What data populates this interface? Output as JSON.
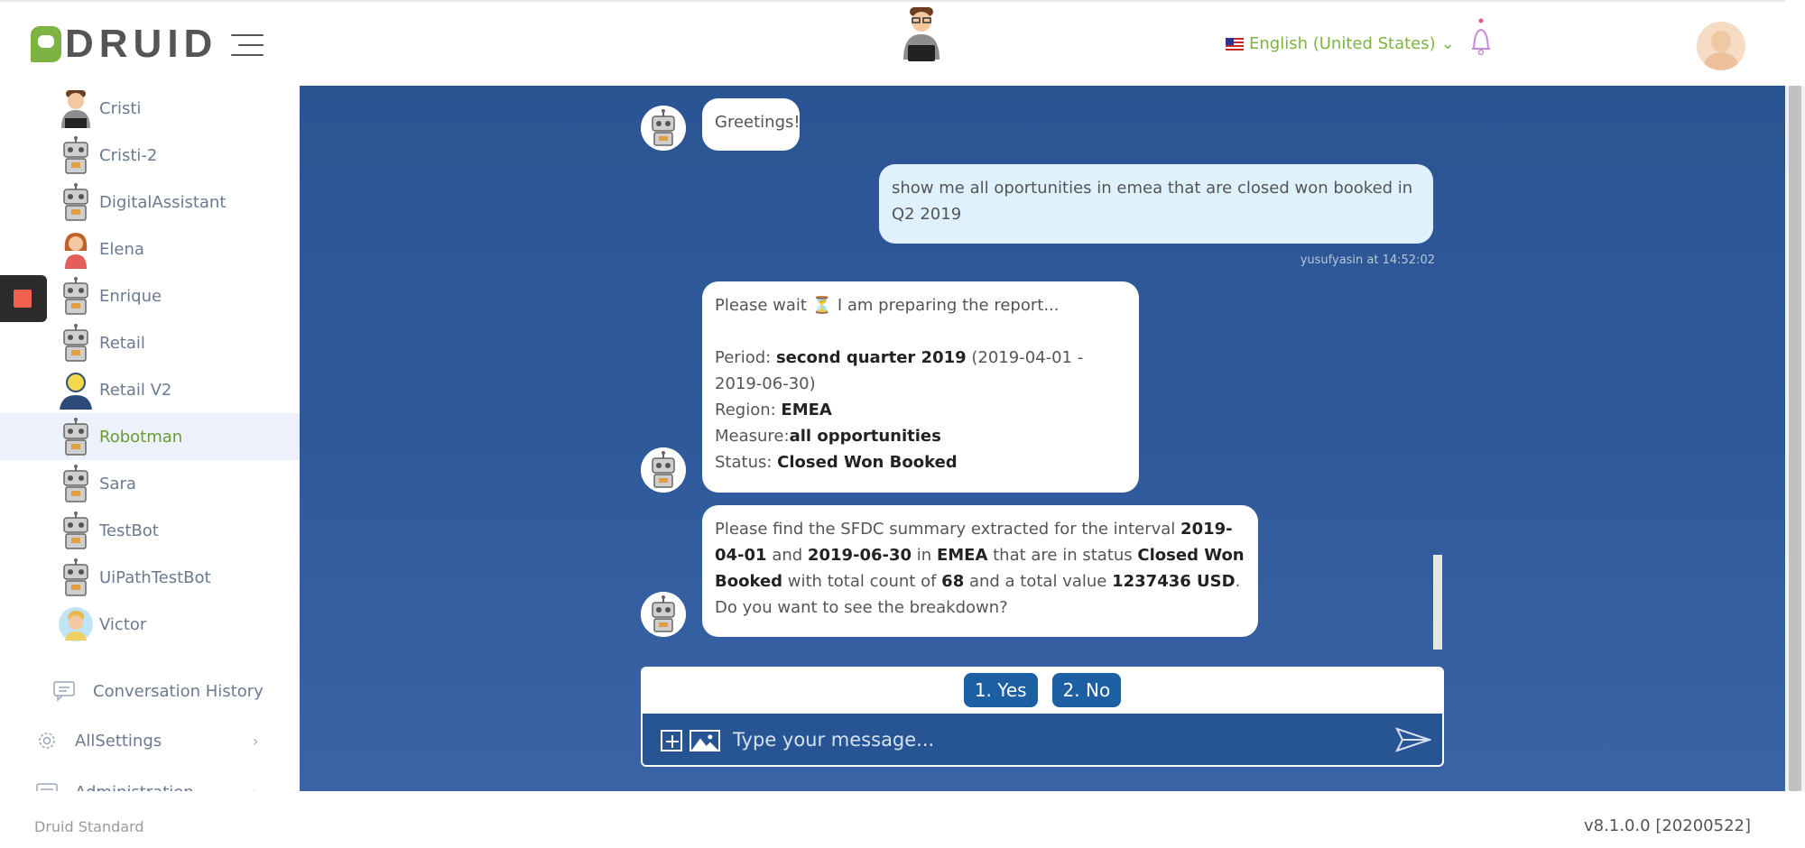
{
  "header": {
    "logo_text": "DRUID",
    "language": "English (United States)"
  },
  "sidebar": {
    "bots": [
      {
        "label": "Cristi",
        "avatar": "person-avatar"
      },
      {
        "label": "Cristi-2",
        "avatar": "robot-avatar"
      },
      {
        "label": "DigitalAssistant",
        "avatar": "robot-avatar"
      },
      {
        "label": "Elena",
        "avatar": "woman-avatar"
      },
      {
        "label": "Enrique",
        "avatar": "robot-avatar"
      },
      {
        "label": "Retail",
        "avatar": "robot-avatar"
      },
      {
        "label": "Retail V2",
        "avatar": "bulb-avatar"
      },
      {
        "label": "Robotman",
        "avatar": "robot-avatar",
        "active": true
      },
      {
        "label": "Sara",
        "avatar": "robot-avatar"
      },
      {
        "label": "TestBot",
        "avatar": "robot-avatar"
      },
      {
        "label": "UiPathTestBot",
        "avatar": "robot-avatar"
      },
      {
        "label": "Victor",
        "avatar": "boy-avatar"
      }
    ],
    "conversation_history": "Conversation History",
    "all_settings": "AllSettings",
    "administration": "Administration"
  },
  "chat": {
    "greeting": "Greetings!",
    "user_message": "show me all oportunities in emea that are closed won booked in Q2 2019",
    "user_meta": "yusufyasin at 14:52:02",
    "report": {
      "wait_prefix": "Please wait",
      "wait_suffix": "I am preparing the report...",
      "period_label": "Period:",
      "period_value": "second quarter 2019",
      "period_range": "(2019-04-01 - 2019-06-30)",
      "region_label": "Region:",
      "region_value": "EMEA",
      "measure_label": "Measure:",
      "measure_value": "all opportunities",
      "status_label": "Status:",
      "status_value": "Closed Won Booked"
    },
    "summary": {
      "t1": "Please find the SFDC summary extracted for the interval",
      "d1": "2019-04-01",
      "t2": "and",
      "d2": "2019-06-30",
      "t3": "in",
      "region": "EMEA",
      "t4": "that are in status",
      "status": "Closed Won Booked",
      "t5": "with total count of",
      "count": "68",
      "t6": "and a total value",
      "value": "1237436 USD",
      "t7": ". Do you want to see the breakdown?"
    },
    "quick_replies": [
      "1. Yes",
      "2. No"
    ],
    "input_placeholder": "Type your message..."
  },
  "footer": {
    "left": "Druid Standard",
    "right": "v8.1.0.0 [20200522]"
  },
  "colors": {
    "accent_green": "#7cb342",
    "chat_bg": "#2b5493",
    "button_blue": "#1d5fa3"
  }
}
